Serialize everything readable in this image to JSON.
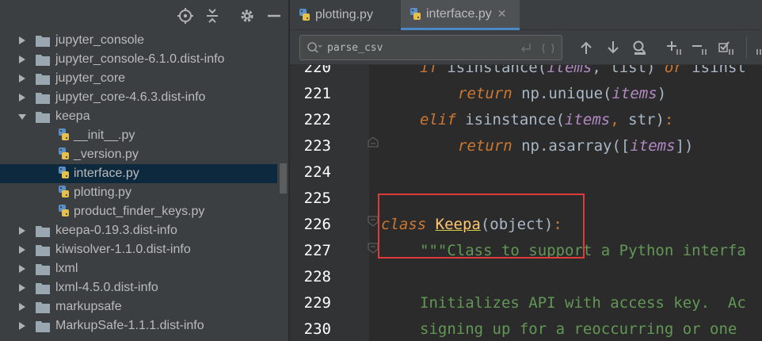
{
  "project_tree": {
    "items": [
      {
        "label": "jupyter_console",
        "kind": "folder",
        "expanded": false,
        "level": 0
      },
      {
        "label": "jupyter_console-6.1.0.dist-info",
        "kind": "folder",
        "expanded": false,
        "level": 0
      },
      {
        "label": "jupyter_core",
        "kind": "folder",
        "expanded": false,
        "level": 0
      },
      {
        "label": "jupyter_core-4.6.3.dist-info",
        "kind": "folder",
        "expanded": false,
        "level": 0
      },
      {
        "label": "keepa",
        "kind": "folder",
        "expanded": true,
        "level": 0
      },
      {
        "label": "__init__.py",
        "kind": "python-file",
        "level": 1
      },
      {
        "label": "_version.py",
        "kind": "python-file",
        "level": 1
      },
      {
        "label": "interface.py",
        "kind": "python-file",
        "level": 1,
        "selected": true
      },
      {
        "label": "plotting.py",
        "kind": "python-file",
        "level": 1
      },
      {
        "label": "product_finder_keys.py",
        "kind": "python-file",
        "level": 1
      },
      {
        "label": "keepa-0.19.3.dist-info",
        "kind": "folder",
        "expanded": false,
        "level": 0
      },
      {
        "label": "kiwisolver-1.1.0.dist-info",
        "kind": "folder",
        "expanded": false,
        "level": 0
      },
      {
        "label": "lxml",
        "kind": "folder",
        "expanded": false,
        "level": 0
      },
      {
        "label": "lxml-4.5.0.dist-info",
        "kind": "folder",
        "expanded": false,
        "level": 0
      },
      {
        "label": "markupsafe",
        "kind": "folder",
        "expanded": false,
        "level": 0
      },
      {
        "label": "MarkupSafe-1.1.1.dist-info",
        "kind": "folder",
        "expanded": false,
        "level": 0
      }
    ]
  },
  "tabs": [
    {
      "label": "plotting.py",
      "active": false
    },
    {
      "label": "interface.py",
      "active": true
    }
  ],
  "tab_close_glyph": "✕",
  "search": {
    "value": "parse_csv"
  },
  "editor": {
    "lines": [
      {
        "num": "220",
        "tokens": [
          [
            "kw",
            "if"
          ],
          [
            "",
            " "
          ],
          [
            "fn",
            "isinstance"
          ],
          [
            "",
            "("
          ],
          [
            "par",
            "items"
          ],
          [
            "",
            ", list) "
          ],
          [
            "kw",
            "or"
          ],
          [
            "",
            " isinst"
          ]
        ]
      },
      {
        "num": "221",
        "tokens": [
          [
            "kw",
            "return"
          ],
          [
            "",
            " np.unique("
          ],
          [
            "par",
            "items"
          ],
          [
            "",
            ")"
          ]
        ]
      },
      {
        "num": "222",
        "tokens": [
          [
            "kw",
            "elif"
          ],
          [
            "",
            " isinstance("
          ],
          [
            "par",
            "items"
          ],
          [
            "kw2",
            ","
          ],
          [
            "",
            " str)"
          ],
          [
            "kw2",
            ":"
          ]
        ]
      },
      {
        "num": "223",
        "tokens": [
          [
            "kw",
            "return"
          ],
          [
            "",
            " np.asarray(["
          ],
          [
            "par",
            "items"
          ],
          [
            "",
            "])"
          ]
        ]
      },
      {
        "num": "224",
        "tokens": []
      },
      {
        "num": "225",
        "tokens": []
      },
      {
        "num": "226",
        "tokens": [
          [
            "kw",
            "class"
          ],
          [
            "",
            " "
          ],
          [
            "cls",
            "Keepa"
          ],
          [
            "",
            "(object)"
          ],
          [
            "kw2",
            ":"
          ]
        ]
      },
      {
        "num": "227",
        "tokens": [
          [
            "doc",
            "\"\"\"Class to support a Python interfa"
          ]
        ]
      },
      {
        "num": "228",
        "tokens": []
      },
      {
        "num": "229",
        "tokens": [
          [
            "doc",
            "Initializes API with access key.  Ac"
          ]
        ]
      },
      {
        "num": "230",
        "tokens": [
          [
            "doc",
            "signing up for a reoccurring or one "
          ]
        ]
      }
    ]
  },
  "colors": {
    "accent": "#4a88c7",
    "highlight_box": "#e03a3a",
    "selection": "#0d293e"
  }
}
